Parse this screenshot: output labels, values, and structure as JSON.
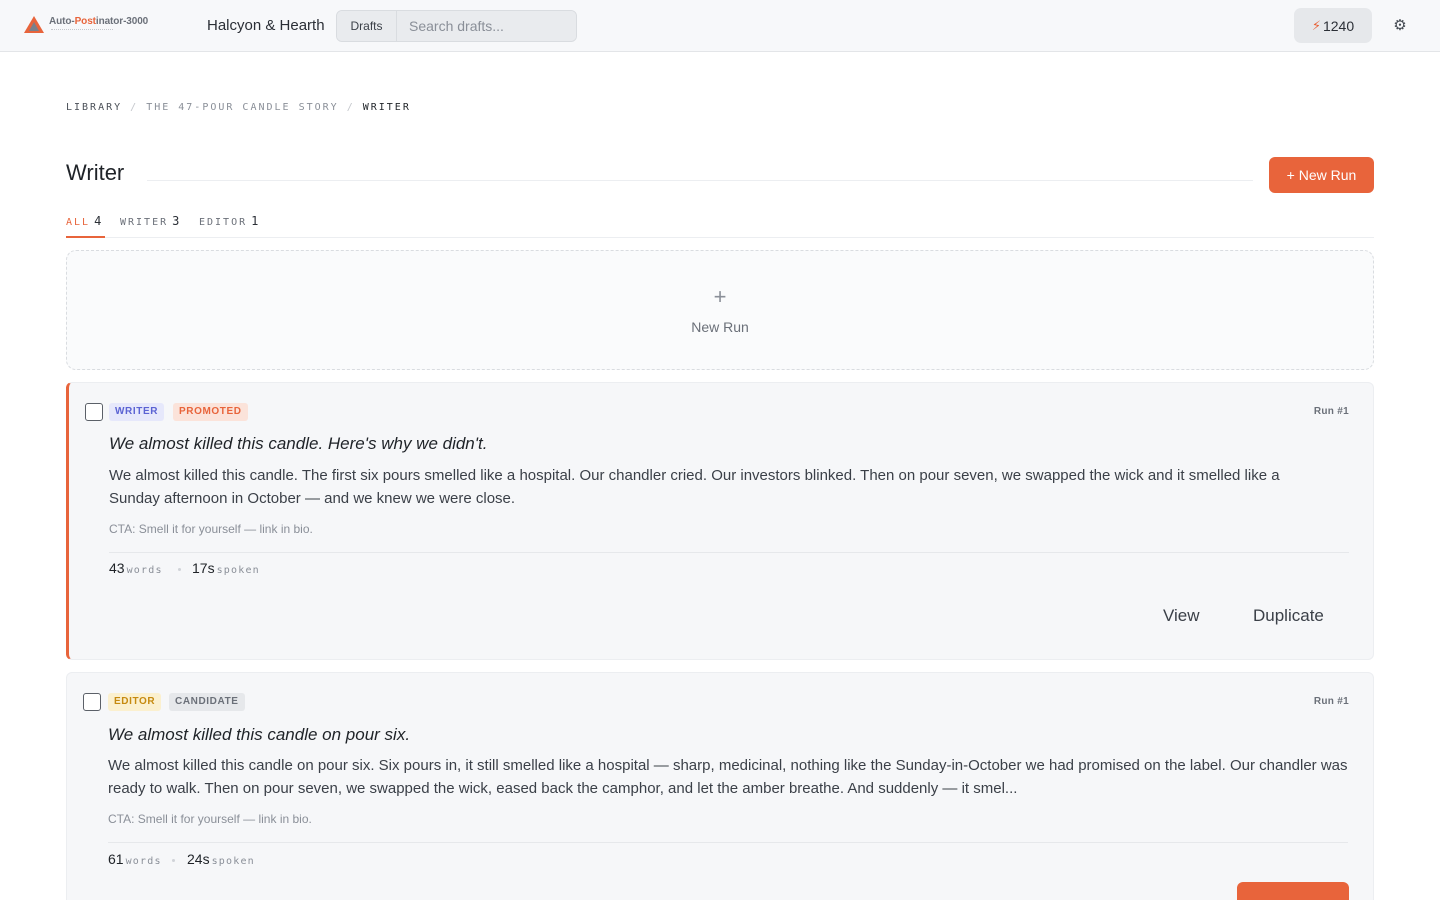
{
  "header": {
    "app_name_prefix": "Auto-",
    "app_name_highlight": "Post",
    "app_name_suffix": "inator-3000",
    "brand": "Halcyon & Hearth",
    "search_scope": "Drafts",
    "search_placeholder": "Search drafts...",
    "credits": "1240",
    "colors": {
      "accent": "#e8643b"
    }
  },
  "breadcrumb": [
    "LIBRARY",
    "THE 47-POUR CANDLE STORY",
    "WRITER"
  ],
  "page": {
    "title": "Writer",
    "new_run_button": "+ New Run"
  },
  "tabs": [
    {
      "label": "ALL",
      "count": "4",
      "active": true
    },
    {
      "label": "WRITER",
      "count": "3",
      "active": false
    },
    {
      "label": "EDITOR",
      "count": "1",
      "active": false
    }
  ],
  "new_run_zone": {
    "icon": "plus-icon",
    "label": "New Run"
  },
  "runs": [
    {
      "role": "WRITER",
      "status": "PROMOTED",
      "run_id": "Run #1",
      "hook": "We almost killed this candle. Here's why we didn't.",
      "body": "We almost killed this candle. The first six pours smelled like a hospital. Our chandler cried. Our investors blinked. Then on pour seven, we swapped the wick and it smelled like a Sunday afternoon in October — and we knew we were close.",
      "cta": "CTA: Smell it for yourself — link in bio.",
      "words": "43",
      "words_unit": "words",
      "spoken": "17s",
      "spoken_unit": "spoken",
      "actions": [
        "View",
        "Duplicate"
      ]
    },
    {
      "role": "EDITOR",
      "status": "CANDIDATE",
      "run_id": "Run #1",
      "hook": "We almost killed this candle on pour six.",
      "body": "We almost killed this candle on pour six. Six pours in, it still smelled like a hospital — sharp, medicinal, nothing like the Sunday-in-October we had promised on the label. Our chandler was ready to walk. Then on pour seven, we swapped the wick, eased back the camphor, and let the amber breathe. And suddenly — it smel...",
      "cta": "CTA: Smell it for yourself — link in bio.",
      "words": "61",
      "words_unit": "words",
      "spoken": "24s",
      "spoken_unit": "spoken"
    }
  ]
}
